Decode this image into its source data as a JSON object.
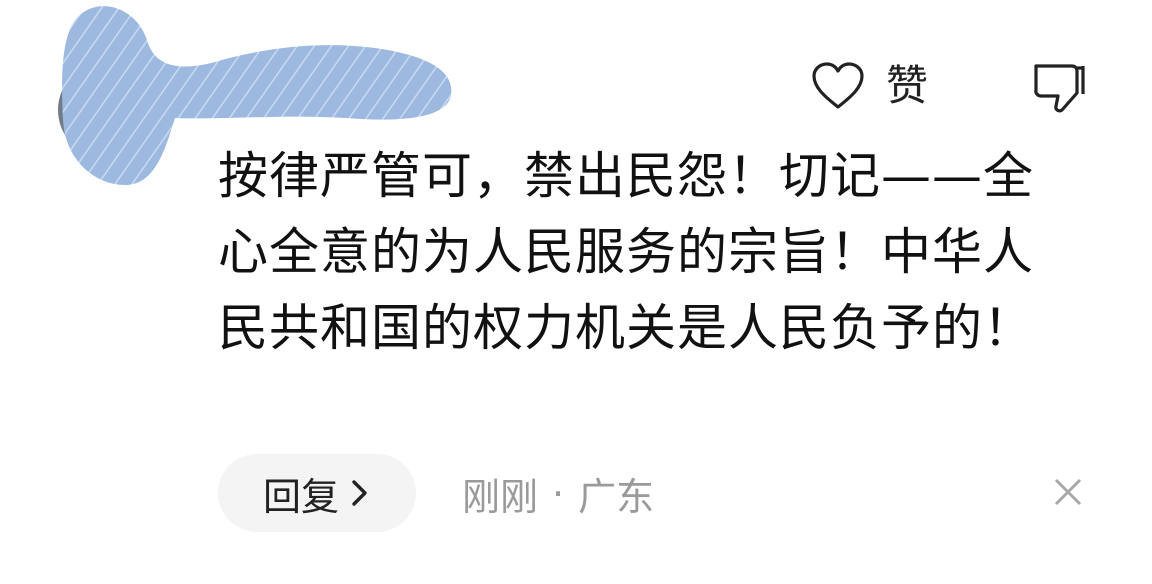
{
  "comment": {
    "username": "",
    "text": "按律严管可，禁出民怨！切记——全心全意的为人民服务的宗旨！中华人民共和国的权力机关是人民负予的！",
    "like_label": "赞",
    "reply_label": "回复",
    "time": "刚刚",
    "separator": "·",
    "location": "广东"
  },
  "icons": {
    "like": "heart-outline-icon",
    "dislike": "thumbs-down-icon",
    "reply_chevron": "chevron-right-icon",
    "close": "close-icon"
  },
  "colors": {
    "text": "#111111",
    "meta": "#9a9a9a",
    "reply_bg": "#f4f4f4",
    "redaction": "#9db9e0"
  }
}
